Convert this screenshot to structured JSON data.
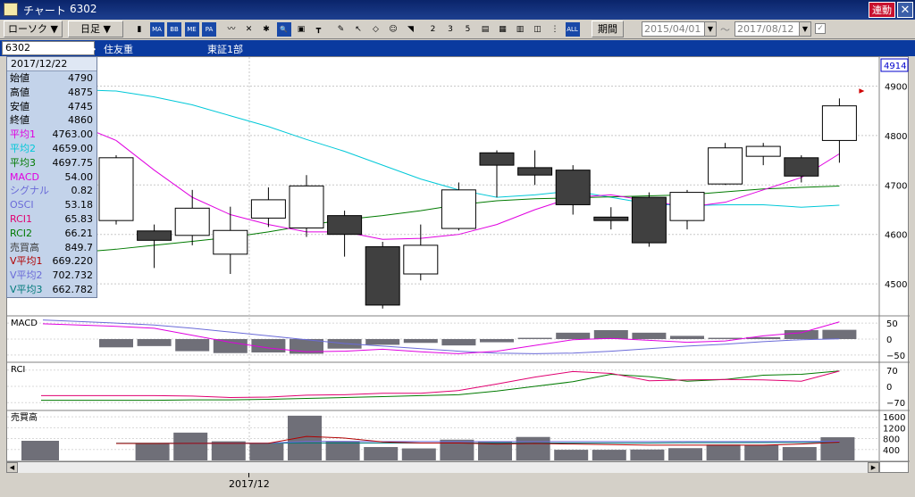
{
  "window": {
    "title": "チャート",
    "code": "6302",
    "link_label": "連動",
    "close_icon": "close-x-icon"
  },
  "toolbar": {
    "rotate_label": "ローソク ▼",
    "period_label": "日足 ▼",
    "span_label": "期間",
    "date_from": "2015/04/01",
    "date_sep": "〜",
    "date_to": "2017/08/12",
    "icons": [
      "candlestick-icon",
      "ma-icon",
      "bb-icon",
      "mae-icon",
      "pa-icon",
      "line-icon",
      "cross-icon",
      "fork-icon",
      "zoom-icon",
      "cursor-icon",
      "bar-icon",
      "pen-icon",
      "arrow-icon",
      "eraser-icon",
      "coin-icon",
      "n-icon",
      "d2-icon",
      "d3-icon",
      "d5-icon",
      "grid-icon",
      "calendar-icon",
      "print-icon",
      "step-icon",
      "range-icon",
      "all-icon"
    ],
    "icon_glyphs": [
      "▮",
      "MA",
      "BB",
      "ME",
      "PA",
      "〰",
      "✕",
      "✱",
      "🔍",
      "▣",
      "┳",
      "✎",
      "↖",
      "◇",
      "☺",
      "◥",
      "2",
      "3",
      "5",
      "▤",
      "▦",
      "▥",
      "◫",
      "⋮",
      "ALL"
    ]
  },
  "codebar": {
    "code": "6302",
    "dot": "・",
    "company": "住友重",
    "market": "東証1部"
  },
  "info": {
    "date": "2017/12/22",
    "rows": [
      {
        "label": "始値",
        "value": "4790",
        "color": "#000000"
      },
      {
        "label": "高値",
        "value": "4875",
        "color": "#000000"
      },
      {
        "label": "安値",
        "value": "4745",
        "color": "#000000"
      },
      {
        "label": "終値",
        "value": "4860",
        "color": "#000000"
      },
      {
        "label": "平均1",
        "value": "4763.00",
        "color": "#e000e0"
      },
      {
        "label": "平均2",
        "value": "4659.00",
        "color": "#00c8d8"
      },
      {
        "label": "平均3",
        "value": "4697.75",
        "color": "#007a00"
      },
      {
        "label": "MACD",
        "value": "54.00",
        "color": "#e000e0"
      },
      {
        "label": "シグナル",
        "value": "0.82",
        "color": "#6a6ad8"
      },
      {
        "label": "OSCI",
        "value": "53.18",
        "color": "#6a6ad8"
      },
      {
        "label": "RCI1",
        "value": "65.83",
        "color": "#e00070"
      },
      {
        "label": "RCI2",
        "value": "66.21",
        "color": "#007a00"
      },
      {
        "label": "売買高",
        "value": "849.7",
        "color": "#404040"
      },
      {
        "label": "V平均1",
        "value": "669.220",
        "color": "#b00000"
      },
      {
        "label": "V平均2",
        "value": "702.732",
        "color": "#6a6ad8"
      },
      {
        "label": "V平均3",
        "value": "662.782",
        "color": "#007a7a"
      }
    ]
  },
  "chart_data": {
    "type": "candlestick",
    "last_price_label": "4914",
    "x_label": "2017/12",
    "price_ticks": [
      "4900",
      "4800",
      "4700",
      "4600",
      "4500"
    ],
    "macd_label": "MACD",
    "macd_ticks": [
      "50",
      "0",
      "−50"
    ],
    "rci_label": "RCI",
    "rci_ticks": [
      "70",
      "0",
      "−70"
    ],
    "vol_label": "売買高",
    "vol_ticks": [
      "1600",
      "1200",
      "800",
      "400"
    ],
    "price_range": [
      4437,
      4955
    ],
    "candles": [
      {
        "o": 4628,
        "c": 4755,
        "h": 4760,
        "l": 4620
      },
      {
        "o": 4607,
        "c": 4588,
        "h": 4620,
        "l": 4532
      },
      {
        "o": 4598,
        "c": 4653,
        "h": 4690,
        "l": 4578
      },
      {
        "o": 4560,
        "c": 4608,
        "h": 4656,
        "l": 4520
      },
      {
        "o": 4633,
        "c": 4670,
        "h": 4695,
        "l": 4615
      },
      {
        "o": 4613,
        "c": 4698,
        "h": 4720,
        "l": 4595
      },
      {
        "o": 4638,
        "c": 4600,
        "h": 4648,
        "l": 4555
      },
      {
        "o": 4575,
        "c": 4457,
        "h": 4585,
        "l": 4450
      },
      {
        "o": 4520,
        "c": 4578,
        "h": 4620,
        "l": 4507
      },
      {
        "o": 4612,
        "c": 4690,
        "h": 4705,
        "l": 4608
      },
      {
        "o": 4765,
        "c": 4740,
        "h": 4770,
        "l": 4675
      },
      {
        "o": 4735,
        "c": 4720,
        "h": 4770,
        "l": 4700
      },
      {
        "o": 4730,
        "c": 4660,
        "h": 4740,
        "l": 4640
      },
      {
        "o": 4635,
        "c": 4628,
        "h": 4655,
        "l": 4610
      },
      {
        "o": 4675,
        "c": 4583,
        "h": 4685,
        "l": 4575
      },
      {
        "o": 4628,
        "c": 4685,
        "h": 4690,
        "l": 4610
      },
      {
        "o": 4702,
        "c": 4775,
        "h": 4785,
        "l": 4700
      },
      {
        "o": 4758,
        "c": 4778,
        "h": 4785,
        "l": 4740
      },
      {
        "o": 4755,
        "c": 4718,
        "h": 4760,
        "l": 4705
      },
      {
        "o": 4790,
        "c": 4860,
        "h": 4875,
        "l": 4745
      }
    ],
    "ma1": [
      4790,
      4730,
      4675,
      4640,
      4620,
      4605,
      4605,
      4590,
      4592,
      4600,
      4620,
      4650,
      4675,
      4680,
      4668,
      4655,
      4665,
      4690,
      4715,
      4763
    ],
    "ma2": [
      4890,
      4878,
      4862,
      4840,
      4818,
      4792,
      4768,
      4740,
      4712,
      4690,
      4675,
      4680,
      4688,
      4675,
      4662,
      4658,
      4660,
      4660,
      4655,
      4659
    ],
    "ma3": [
      4570,
      4578,
      4586,
      4594,
      4605,
      4618,
      4630,
      4638,
      4648,
      4660,
      4668,
      4672,
      4674,
      4676,
      4678,
      4680,
      4686,
      4692,
      4695,
      4697.75
    ],
    "macd_range": [
      -70,
      70
    ],
    "macd_hist": [
      -26,
      -22,
      -38,
      -44,
      -42,
      -46,
      -30,
      -18,
      -12,
      -20,
      -10,
      4,
      20,
      28,
      20,
      10,
      4,
      6,
      28,
      29
    ],
    "macd_line": [
      40,
      34,
      12,
      -10,
      -28,
      -40,
      -38,
      -32,
      -40,
      -46,
      -38,
      -20,
      -2,
      2,
      -4,
      -10,
      -6,
      10,
      20,
      54
    ],
    "macd_signal": [
      50,
      44,
      34,
      22,
      10,
      -2,
      -14,
      -22,
      -30,
      -38,
      -44,
      -46,
      -44,
      -38,
      -30,
      -22,
      -16,
      -8,
      -2,
      0.82
    ],
    "rci_range": [
      -100,
      100
    ],
    "rci1": [
      -40,
      -40,
      -42,
      -48,
      -46,
      -38,
      -36,
      -30,
      -30,
      -18,
      10,
      40,
      64,
      56,
      24,
      28,
      30,
      28,
      22,
      65.83
    ],
    "rci2": [
      -60,
      -60,
      -58,
      -58,
      -56,
      -52,
      -48,
      -44,
      -40,
      -36,
      -20,
      0,
      20,
      52,
      42,
      22,
      30,
      48,
      52,
      66.21
    ],
    "vol_range": [
      0,
      1800
    ],
    "volume": [
      720,
      640,
      1020,
      700,
      620,
      1640,
      700,
      490,
      440,
      760,
      700,
      860,
      390,
      390,
      400,
      450,
      580,
      560,
      490,
      849.7
    ],
    "vma1": [
      620,
      620,
      625,
      625,
      630,
      880,
      820,
      680,
      640,
      640,
      600,
      620,
      600,
      580,
      560,
      560,
      560,
      560,
      600,
      669.22
    ],
    "vma2": [
      620,
      620,
      625,
      630,
      635,
      700,
      700,
      690,
      690,
      690,
      690,
      690,
      690,
      690,
      690,
      690,
      690,
      690,
      695,
      702.732
    ],
    "vma3": [
      630,
      630,
      630,
      630,
      630,
      640,
      640,
      640,
      640,
      640,
      640,
      640,
      640,
      640,
      640,
      650,
      650,
      655,
      660,
      662.782
    ]
  }
}
